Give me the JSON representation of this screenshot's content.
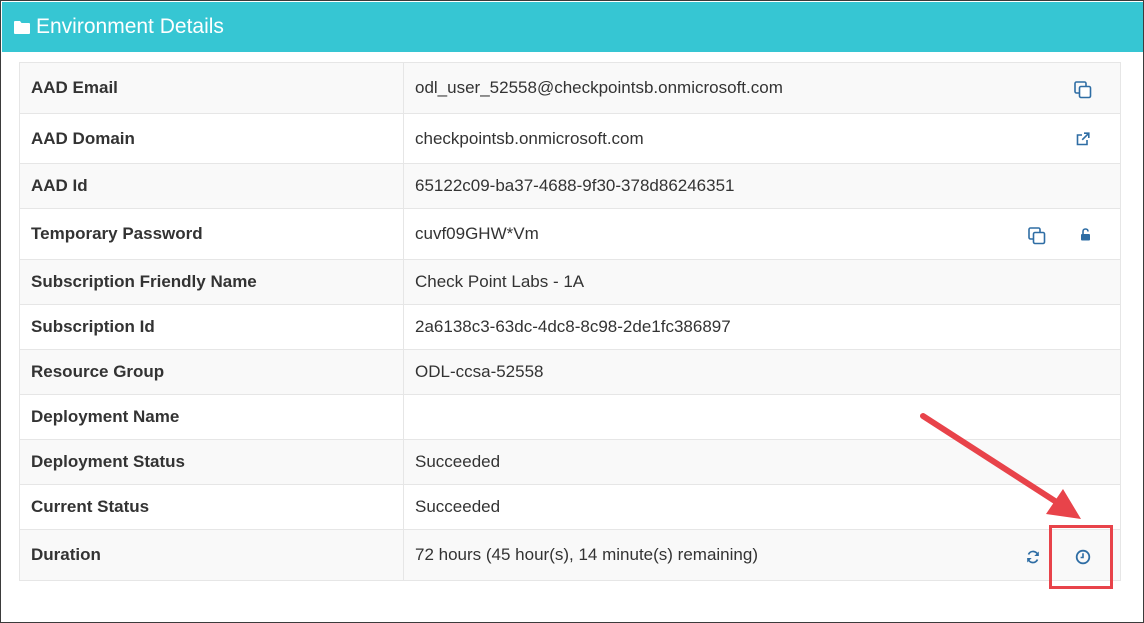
{
  "panel": {
    "title": "Environment Details",
    "header_color": "#36c6d3",
    "icon": "folder-icon"
  },
  "rows": [
    {
      "label": "AAD Email",
      "value": "odl_user_52558@checkpointsb.onmicrosoft.com",
      "icons": [
        "copy-icon"
      ]
    },
    {
      "label": "AAD Domain",
      "value": "checkpointsb.onmicrosoft.com",
      "icons": [
        "external-link-icon"
      ]
    },
    {
      "label": "AAD Id",
      "value": "65122c09-ba37-4688-9f30-378d86246351",
      "icons": []
    },
    {
      "label": "Temporary Password",
      "value": "cuvf09GHW*Vm",
      "icons": [
        "copy-icon",
        "unlock-icon"
      ]
    },
    {
      "label": "Subscription Friendly Name",
      "value": "Check Point Labs - 1A",
      "icons": []
    },
    {
      "label": "Subscription Id",
      "value": "2a6138c3-63dc-4dc8-8c98-2de1fc386897",
      "icons": []
    },
    {
      "label": "Resource Group",
      "value": "ODL-ccsa-52558",
      "icons": []
    },
    {
      "label": "Deployment Name",
      "value": "",
      "icons": []
    },
    {
      "label": "Deployment Status",
      "value": "Succeeded",
      "icons": []
    },
    {
      "label": "Current Status",
      "value": "Succeeded",
      "icons": []
    },
    {
      "label": "Duration",
      "value": "72 hours (45 hour(s), 14 minute(s) remaining)",
      "icons": [
        "refresh-icon",
        "clock-icon"
      ]
    }
  ],
  "annotation": {
    "color": "#e8434a",
    "target": "clock-icon"
  },
  "icon_color": "#2e6da4"
}
